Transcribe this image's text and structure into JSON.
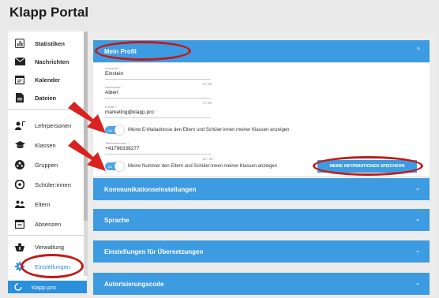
{
  "app": {
    "title": "Klapp Portal"
  },
  "sidebar": {
    "items": [
      {
        "label": "Statistiken",
        "icon": "bar-chart-icon"
      },
      {
        "label": "Nachrichten",
        "icon": "envelope-icon"
      },
      {
        "label": "Kalender",
        "icon": "calendar-icon"
      },
      {
        "label": "Dateien",
        "icon": "file-icon"
      },
      {
        "label": "Lehrpersonen",
        "icon": "teacher-icon"
      },
      {
        "label": "Klassen",
        "icon": "graduation-cap-icon"
      },
      {
        "label": "Gruppen",
        "icon": "groups-icon"
      },
      {
        "label": "Schüler:innen",
        "icon": "student-icon"
      },
      {
        "label": "Eltern",
        "icon": "parents-icon"
      },
      {
        "label": "Absenzen",
        "icon": "absences-icon"
      },
      {
        "label": "Verwaltung",
        "icon": "admin-icon"
      },
      {
        "label": "Einstellungen",
        "icon": "gear-icon"
      }
    ],
    "bottom": {
      "label": "klapp.pro",
      "icon": "klapp-logo-icon"
    }
  },
  "profile": {
    "header": "Mein Profil",
    "fields": [
      {
        "label": "Vorname *",
        "value": "Einstein",
        "counter": "8 / 50"
      },
      {
        "label": "Nachname *",
        "value": "Albert",
        "counter": "6 / 50"
      },
      {
        "label": "E-Mail *",
        "value": "marketing@klapp.pro",
        "counter": ""
      },
      {
        "label": "Telefonnummer *",
        "value": "+41796338277",
        "counter": "12 / 20"
      }
    ],
    "toggle_on_label": "An",
    "email_toggle_text": "Meine E-Mailadresse den Eltern und Schüler:innen meiner Klassen anzeigen",
    "phone_toggle_text": "Meine Nummer den Eltern und Schüler:innen meiner Klassen anzeigen",
    "save_button": "MEINE INFORMATIONEN SPEICHERN"
  },
  "sections": [
    {
      "label": "Kommunikationseinstellungen"
    },
    {
      "label": "Sprache"
    },
    {
      "label": "Einstellungen für Übersetzungen"
    },
    {
      "label": "Autorisierungscode"
    }
  ],
  "colors": {
    "accent": "#3d9be1",
    "annotation": "#c11a1a",
    "arrow": "#d9221f"
  }
}
